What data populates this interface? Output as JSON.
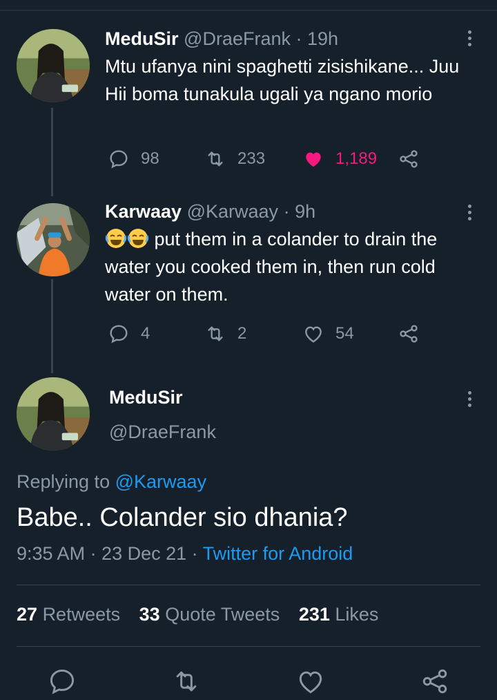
{
  "tweets": [
    {
      "name": "MeduSir",
      "handle": "@DraeFrank",
      "time": "19h",
      "text": "Mtu ufanya nini spaghetti zisishikane... Juu Hii boma tunakula ugali ya ngano morio",
      "replies": "98",
      "retweets": "233",
      "likes": "1,189",
      "liked": true
    },
    {
      "name": "Karwaay",
      "handle": "@Karwaay",
      "time": "9h",
      "emoji": "😂😂",
      "text": "put them in a colander to drain the water you cooked them in,  then run cold water on them.",
      "replies": "4",
      "retweets": "2",
      "likes": "54",
      "liked": false
    }
  ],
  "main": {
    "name": "MeduSir",
    "handle": "@DraeFrank",
    "replying_label": "Replying to",
    "replying_to": "@Karwaay",
    "text": "Babe.. Colander sio dhania?",
    "timestamp": "9:35 AM · 23 Dec 21 · ",
    "source": "Twitter for Android",
    "stats": {
      "retweets_count": "27",
      "retweets_label": "Retweets",
      "quotes_count": "33",
      "quotes_label": "Quote Tweets",
      "likes_count": "231",
      "likes_label": "Likes"
    }
  },
  "icons": [
    "reply-icon",
    "retweet-icon",
    "like-icon",
    "share-icon",
    "more-icon"
  ],
  "colors": {
    "background": "#15202b",
    "accent": "#1d9bf0",
    "like": "#f91880",
    "muted": "#8b98a5"
  }
}
